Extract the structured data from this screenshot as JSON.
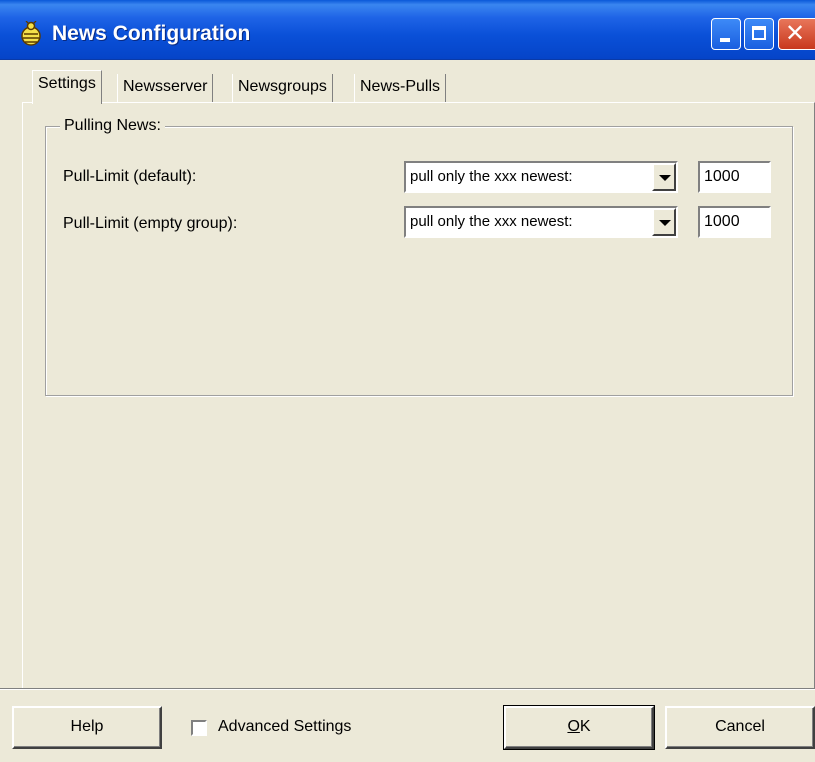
{
  "window": {
    "title": "News Configuration"
  },
  "tabs": [
    {
      "label": "Settings",
      "active": true
    },
    {
      "label": "Newsserver",
      "active": false
    },
    {
      "label": "Newsgroups",
      "active": false
    },
    {
      "label": "News-Pulls",
      "active": false
    }
  ],
  "group": {
    "legend": "Pulling News:",
    "rows": [
      {
        "label": "Pull-Limit (default):",
        "mode": "pull only the xxx newest:",
        "count": "1000"
      },
      {
        "label": "Pull-Limit (empty group):",
        "mode": "pull only the xxx newest:",
        "count": "1000"
      }
    ]
  },
  "footer": {
    "help_label": "Help",
    "advanced_label": "Advanced Settings",
    "advanced_checked": false,
    "ok_label": "OK",
    "cancel_label": "Cancel"
  },
  "colors": {
    "titlebar": "#0a50d8",
    "face": "#ece9d8",
    "close_button": "#c8381e"
  },
  "icons": [
    "app-icon",
    "minimize-icon",
    "maximize-icon",
    "close-icon",
    "dropdown-arrow-icon"
  ]
}
